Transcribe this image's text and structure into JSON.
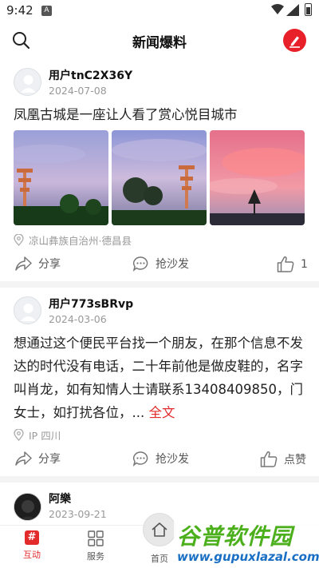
{
  "status_bar": {
    "time": "9:42",
    "notification": "A"
  },
  "header": {
    "title": "新闻爆料"
  },
  "posts": [
    {
      "author": "用户tnC2X36Y",
      "date": "2024-07-08",
      "text": "凤凰古城是一座让人看了赏心悦目城市",
      "location": "凉山彝族自治州·德昌县",
      "share_label": "分享",
      "comment_label": "抢沙发",
      "like_label": "1"
    },
    {
      "author": "用户773sBRvp",
      "date": "2024-03-06",
      "text": "想通过这个便民平台找一个朋友，在那个信息不发达的时代没有电话，二十年前他是做皮鞋的，名字叫肖龙，如有知情人士请联系13408409850，门女士，如打扰各位，...",
      "more_label": " 全文",
      "location": "IP 四川",
      "share_label": "分享",
      "comment_label": "抢沙发",
      "like_label": "点赞"
    },
    {
      "author": "阿樂",
      "date": "2023-09-21"
    }
  ],
  "tab_bar": {
    "tabs": [
      {
        "label": "互动",
        "icon": "#"
      },
      {
        "label": "服务"
      },
      {
        "label": "首页"
      }
    ]
  },
  "watermark": {
    "brand": "谷普软件园",
    "url": "www.gupuxlazal.com"
  }
}
